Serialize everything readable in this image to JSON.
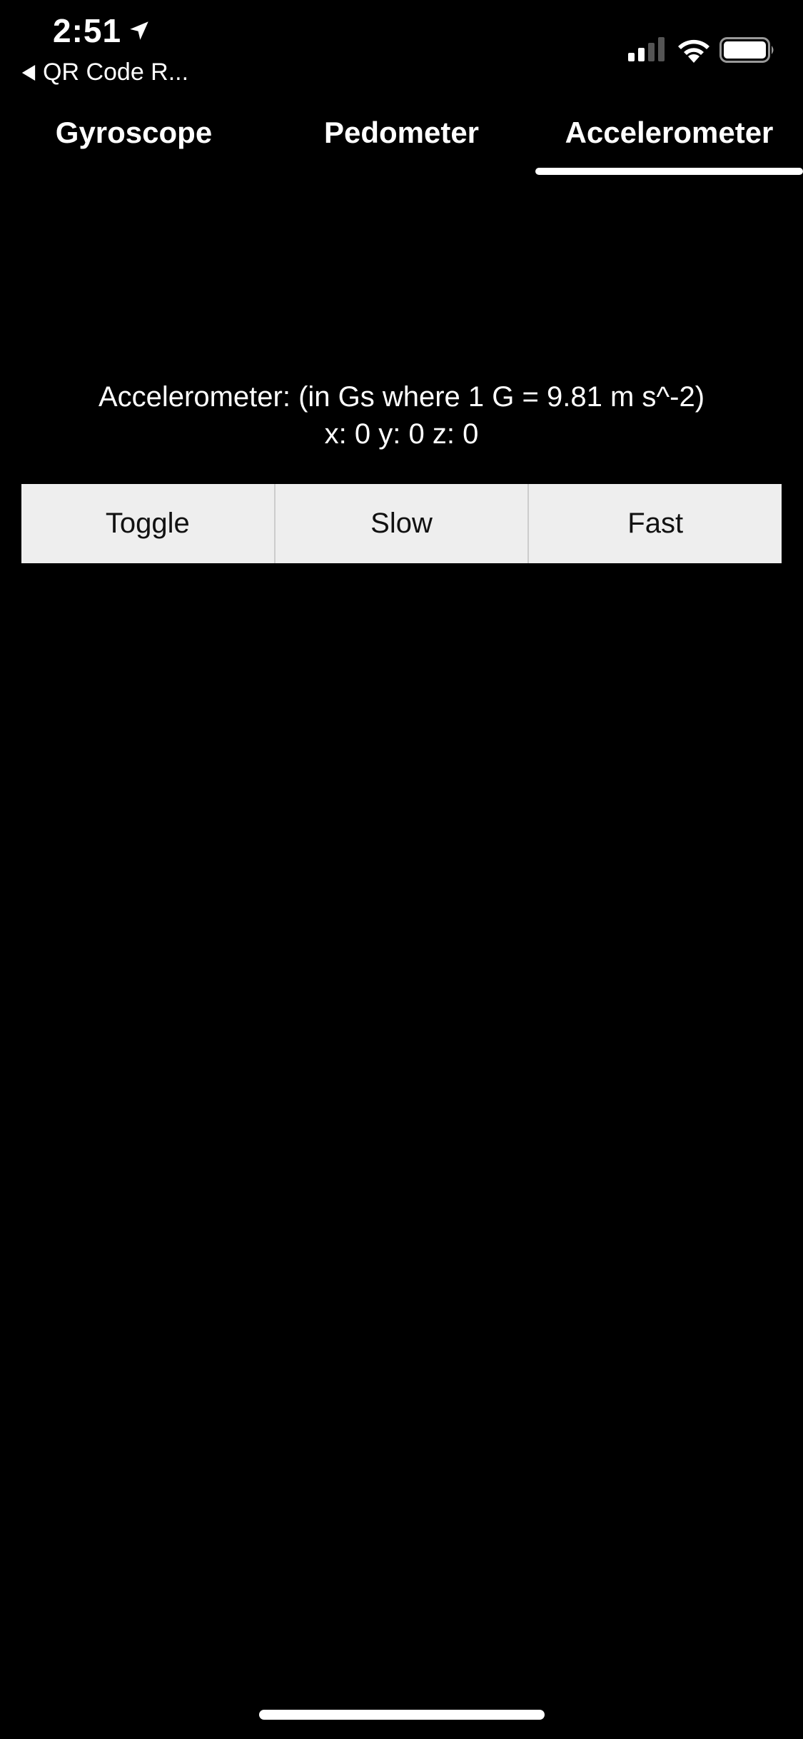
{
  "status_bar": {
    "time": "2:51",
    "back_app": "QR Code R...",
    "icons": [
      "location-arrow-icon",
      "back-triangle-icon",
      "signal-icon",
      "wifi-icon",
      "battery-icon"
    ]
  },
  "tabs": [
    {
      "label": "Gyroscope",
      "selected": false
    },
    {
      "label": "Pedometer",
      "selected": false
    },
    {
      "label": "Accelerometer",
      "selected": true
    }
  ],
  "accelerometer": {
    "label": "Accelerometer: (in Gs where 1 G = 9.81 m s^-2)",
    "values": "x: 0 y: 0 z: 0"
  },
  "buttons": {
    "toggle": "Toggle",
    "slow": "Slow",
    "fast": "Fast"
  },
  "colors": {
    "background": "#000000",
    "text": "#ffffff",
    "button_bg": "#eeeeee",
    "button_text": "#111111"
  }
}
